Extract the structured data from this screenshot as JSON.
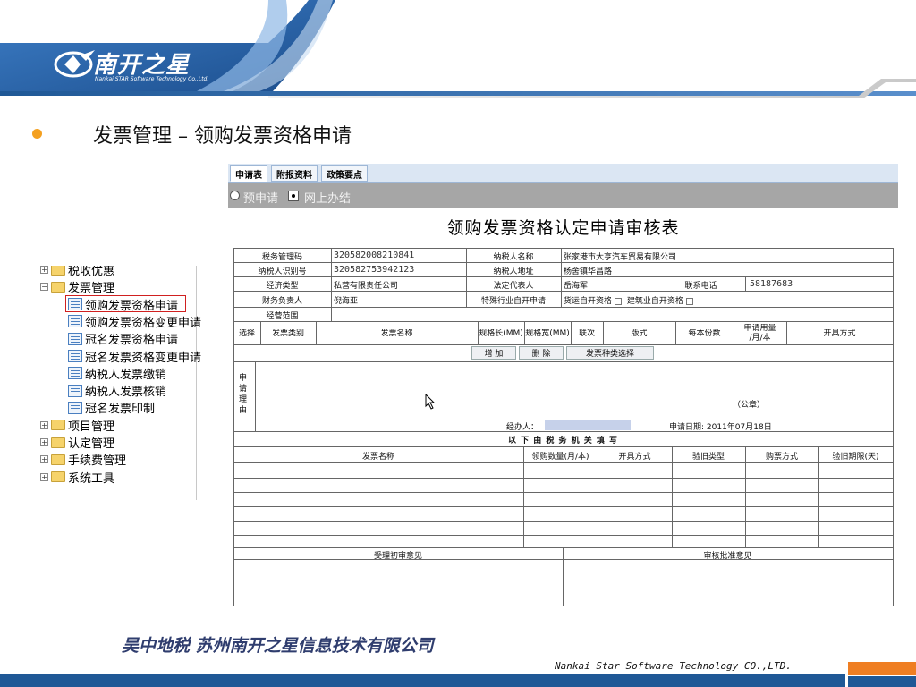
{
  "slide": {
    "title": "发票管理 – 领购发票资格申请",
    "footer_company": "吴中地税    苏州南开之星信息技术有限公司",
    "footer_english": "Nankai Star Software Technology CO.,LTD."
  },
  "logo": {
    "name_cn": "南开之星",
    "name_en": "Nankai STAR Software Technology Co.,Ltd."
  },
  "tree": {
    "items": [
      {
        "label": "税收优惠",
        "type": "folder",
        "expander": "+"
      },
      {
        "label": "发票管理",
        "type": "folder",
        "expander": "−"
      },
      {
        "label": "领购发票资格申请",
        "type": "doc",
        "selected": true
      },
      {
        "label": "领购发票资格变更申请",
        "type": "doc"
      },
      {
        "label": "冠名发票资格申请",
        "type": "doc"
      },
      {
        "label": "冠名发票资格变更申请",
        "type": "doc"
      },
      {
        "label": "纳税人发票缴销",
        "type": "doc"
      },
      {
        "label": "纳税人发票核销",
        "type": "doc"
      },
      {
        "label": "冠名发票印制",
        "type": "doc"
      },
      {
        "label": "项目管理",
        "type": "folder",
        "expander": "+"
      },
      {
        "label": "认定管理",
        "type": "folder",
        "expander": "+"
      },
      {
        "label": "手续费管理",
        "type": "folder",
        "expander": "+"
      },
      {
        "label": "系统工具",
        "type": "folder",
        "expander": "+"
      }
    ]
  },
  "form": {
    "tabs": [
      "申请表",
      "附报资料",
      "政策要点"
    ],
    "active_tab": "申请表",
    "mode_options": [
      "预申请",
      "网上办结"
    ],
    "mode_selected": "网上办结",
    "title": "领购发票资格认定申请审核表",
    "fields": {
      "tax_code_label": "税务管理码",
      "tax_code_value": "320582008210841",
      "taxpayer_name_label": "纳税人名称",
      "taxpayer_name_value": "张家港市大亨汽车贸易有限公司",
      "taxpayer_id_label": "纳税人识别号",
      "taxpayer_id_value": "320582753942123",
      "address_label": "纳税人地址",
      "address_value": "杨舍镇华昌路",
      "econ_type_label": "经济类型",
      "econ_type_value": "私营有限责任公司",
      "legal_rep_label": "法定代表人",
      "legal_rep_value": "岳海军",
      "phone_label": "联系电话",
      "phone_value": "58187683",
      "finance_label": "财务负责人",
      "finance_value": "倪海亚",
      "special_label": "特殊行业自开申请",
      "special_opt1": "货运自开资格",
      "special_opt2": "建筑业自开资格",
      "scope_label": "经营范围",
      "scope_value": ""
    },
    "invoice_headers": [
      "选择",
      "发票类别",
      "发票名称",
      "规格长(MM)",
      "规格宽(MM)",
      "联次",
      "版式",
      "每本份数",
      "申请用量\n/月/本",
      "开具方式"
    ],
    "buttons": [
      "增 加",
      "删 除",
      "发票种类选择"
    ],
    "reason_label": "申\n请\n理\n由",
    "seal_text": "（公章）",
    "agent_label": "经办人：",
    "date_label": "申请日期: 2011年07月18日",
    "official_header": "以 下 由 税 务 机 关 填 写",
    "official_columns": [
      "发票名称",
      "领购数量(月/本)",
      "开具方式",
      "验旧类型",
      "购票方式",
      "验旧期限(天)"
    ],
    "opinion_left": "受理初审意见",
    "opinion_right": "审核批准意见"
  },
  "colors": {
    "accent_orange": "#ef7e22",
    "brand_blue": "#1f5896",
    "bullet": "#f4a020"
  }
}
